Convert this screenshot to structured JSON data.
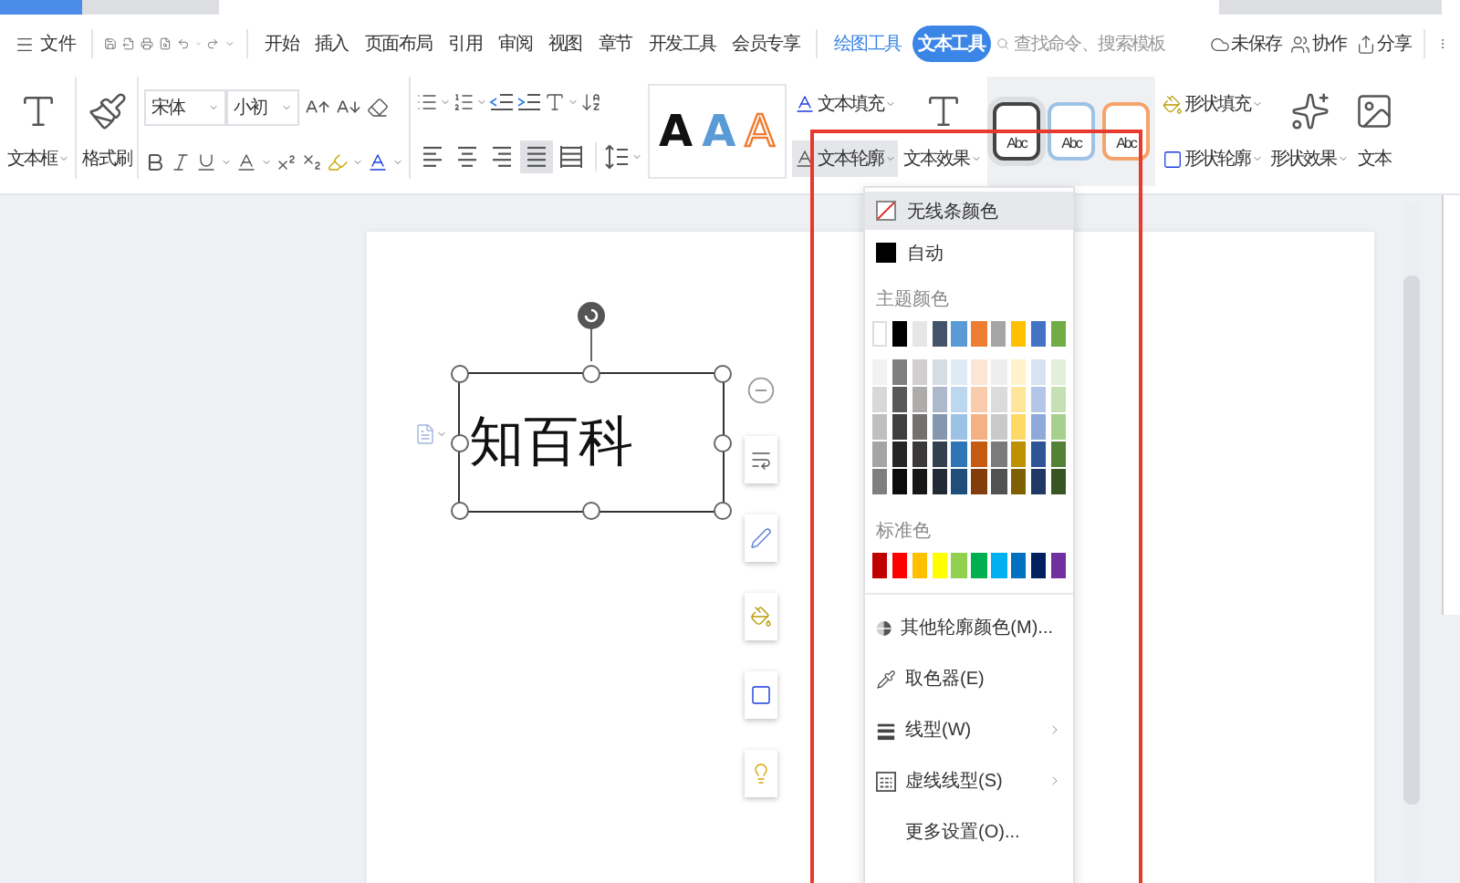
{
  "menu_bar": {
    "file_menu": "文件",
    "tabs": [
      {
        "label": "开始",
        "kind": "main",
        "selected": false
      },
      {
        "label": "插入",
        "kind": "main",
        "selected": false
      },
      {
        "label": "页面布局",
        "kind": "main",
        "selected": false
      },
      {
        "label": "引用",
        "kind": "main",
        "selected": false
      },
      {
        "label": "审阅",
        "kind": "main",
        "selected": false
      },
      {
        "label": "视图",
        "kind": "main",
        "selected": false
      },
      {
        "label": "章节",
        "kind": "main",
        "selected": false
      },
      {
        "label": "开发工具",
        "kind": "main",
        "selected": false
      },
      {
        "label": "会员专享",
        "kind": "main",
        "selected": false
      },
      {
        "label": "绘图工具",
        "kind": "context",
        "selected": false
      },
      {
        "label": "文本工具",
        "kind": "context",
        "selected": true
      }
    ],
    "search": {
      "placeholder": "查找命令、搜索模板"
    },
    "actions": [
      {
        "label": "未保存",
        "kind": "cloud"
      },
      {
        "label": "协作",
        "kind": "collab"
      },
      {
        "label": "分享",
        "kind": "share"
      }
    ]
  },
  "ribbon": {
    "text_box": "文本框",
    "format_painter": "格式刷",
    "font": {
      "family": "宋体",
      "size": "小初"
    },
    "alignment": [
      {
        "kind": "left",
        "selected": false
      },
      {
        "kind": "center",
        "selected": false
      },
      {
        "kind": "right",
        "selected": false
      },
      {
        "kind": "justify",
        "selected": true
      },
      {
        "kind": "distributed",
        "selected": false
      }
    ],
    "style_gallery": [
      {
        "text": "A",
        "kind": "dark"
      },
      {
        "text": "A",
        "kind": "blue"
      },
      {
        "text": "A",
        "kind": "outline"
      }
    ],
    "text_commands": [
      {
        "label": "文本填充",
        "kind": "fill",
        "pressed": false
      },
      {
        "label": "文本轮廓",
        "kind": "outline",
        "pressed": true
      }
    ],
    "text_effects": "文本效果",
    "shape_styles": [
      {
        "text": "Abc",
        "kind": "dark",
        "selected": true
      },
      {
        "text": "Abc",
        "kind": "blue",
        "selected": false
      },
      {
        "text": "Abc",
        "kind": "orange",
        "selected": false
      }
    ],
    "shape_commands": [
      {
        "label": "形状填充",
        "kind": "fill"
      },
      {
        "label": "形状轮廓",
        "kind": "outline"
      }
    ],
    "shape_effects": "形状效果",
    "text_box_edge": "文本"
  },
  "document": {
    "text_box": "知百科"
  },
  "dropdown": {
    "options": [
      {
        "label": "无线条颜色",
        "kind": "none",
        "selected": true
      },
      {
        "label": "自动",
        "kind": "auto",
        "selected": false
      }
    ],
    "theme_heading": "主题颜色",
    "theme_colors": [
      {
        "color": "#ffffff"
      },
      {
        "color": "#000000"
      },
      {
        "color": "#e7e6e6"
      },
      {
        "color": "#44546a"
      },
      {
        "color": "#5b9bd5"
      },
      {
        "color": "#ed7d31"
      },
      {
        "color": "#a5a5a5"
      },
      {
        "color": "#ffc000"
      },
      {
        "color": "#4472c4"
      },
      {
        "color": "#70ad47"
      }
    ],
    "theme_shades": [
      {
        "swatches": [
          {
            "color": "#f2f2f2"
          },
          {
            "color": "#7f7f7f"
          },
          {
            "color": "#d0cece"
          },
          {
            "color": "#d6dce4"
          },
          {
            "color": "#deebf6"
          },
          {
            "color": "#fbe5d5"
          },
          {
            "color": "#ededed"
          },
          {
            "color": "#fff2cc"
          },
          {
            "color": "#d9e2f3"
          },
          {
            "color": "#e2efd9"
          }
        ]
      },
      {
        "swatches": [
          {
            "color": "#d8d8d8"
          },
          {
            "color": "#595959"
          },
          {
            "color": "#aeabab"
          },
          {
            "color": "#adb9ca"
          },
          {
            "color": "#bdd7ee"
          },
          {
            "color": "#f7cbac"
          },
          {
            "color": "#dbdbdb"
          },
          {
            "color": "#fee599"
          },
          {
            "color": "#b4c6e7"
          },
          {
            "color": "#c5e0b3"
          }
        ]
      },
      {
        "swatches": [
          {
            "color": "#bfbfbf"
          },
          {
            "color": "#3f3f3f"
          },
          {
            "color": "#757070"
          },
          {
            "color": "#8496b0"
          },
          {
            "color": "#9cc3e5"
          },
          {
            "color": "#f4b183"
          },
          {
            "color": "#c9c9c9"
          },
          {
            "color": "#ffd965"
          },
          {
            "color": "#8eaadb"
          },
          {
            "color": "#a8d08d"
          }
        ]
      },
      {
        "swatches": [
          {
            "color": "#a5a5a5"
          },
          {
            "color": "#262626"
          },
          {
            "color": "#3a3838"
          },
          {
            "color": "#323f4f"
          },
          {
            "color": "#2e75b5"
          },
          {
            "color": "#c55a11"
          },
          {
            "color": "#7b7b7b"
          },
          {
            "color": "#bf9000"
          },
          {
            "color": "#2f5496"
          },
          {
            "color": "#538135"
          }
        ]
      },
      {
        "swatches": [
          {
            "color": "#7f7f7f"
          },
          {
            "color": "#0c0c0c"
          },
          {
            "color": "#171616"
          },
          {
            "color": "#222a35"
          },
          {
            "color": "#1e4e79"
          },
          {
            "color": "#833c0b"
          },
          {
            "color": "#525252"
          },
          {
            "color": "#7f6000"
          },
          {
            "color": "#1f3864"
          },
          {
            "color": "#375623"
          }
        ]
      }
    ],
    "standard_heading": "标准色",
    "standard_colors": [
      {
        "color": "#c00000"
      },
      {
        "color": "#ff0000"
      },
      {
        "color": "#ffc000"
      },
      {
        "color": "#ffff00"
      },
      {
        "color": "#92d050"
      },
      {
        "color": "#00b050"
      },
      {
        "color": "#00b0f0"
      },
      {
        "color": "#0070c0"
      },
      {
        "color": "#002060"
      },
      {
        "color": "#7030a0"
      }
    ],
    "commands": [
      {
        "label": "其他轮廓颜色(M)...",
        "kind": "palette",
        "submenu": false
      },
      {
        "label": "取色器(E)",
        "kind": "picker",
        "submenu": false
      },
      {
        "label": "线型(W)",
        "kind": "lines",
        "submenu": true
      },
      {
        "label": "虚线线型(S)",
        "kind": "dash",
        "submenu": true
      },
      {
        "label": "更多设置(O)...",
        "kind": "plain",
        "submenu": false
      }
    ]
  }
}
